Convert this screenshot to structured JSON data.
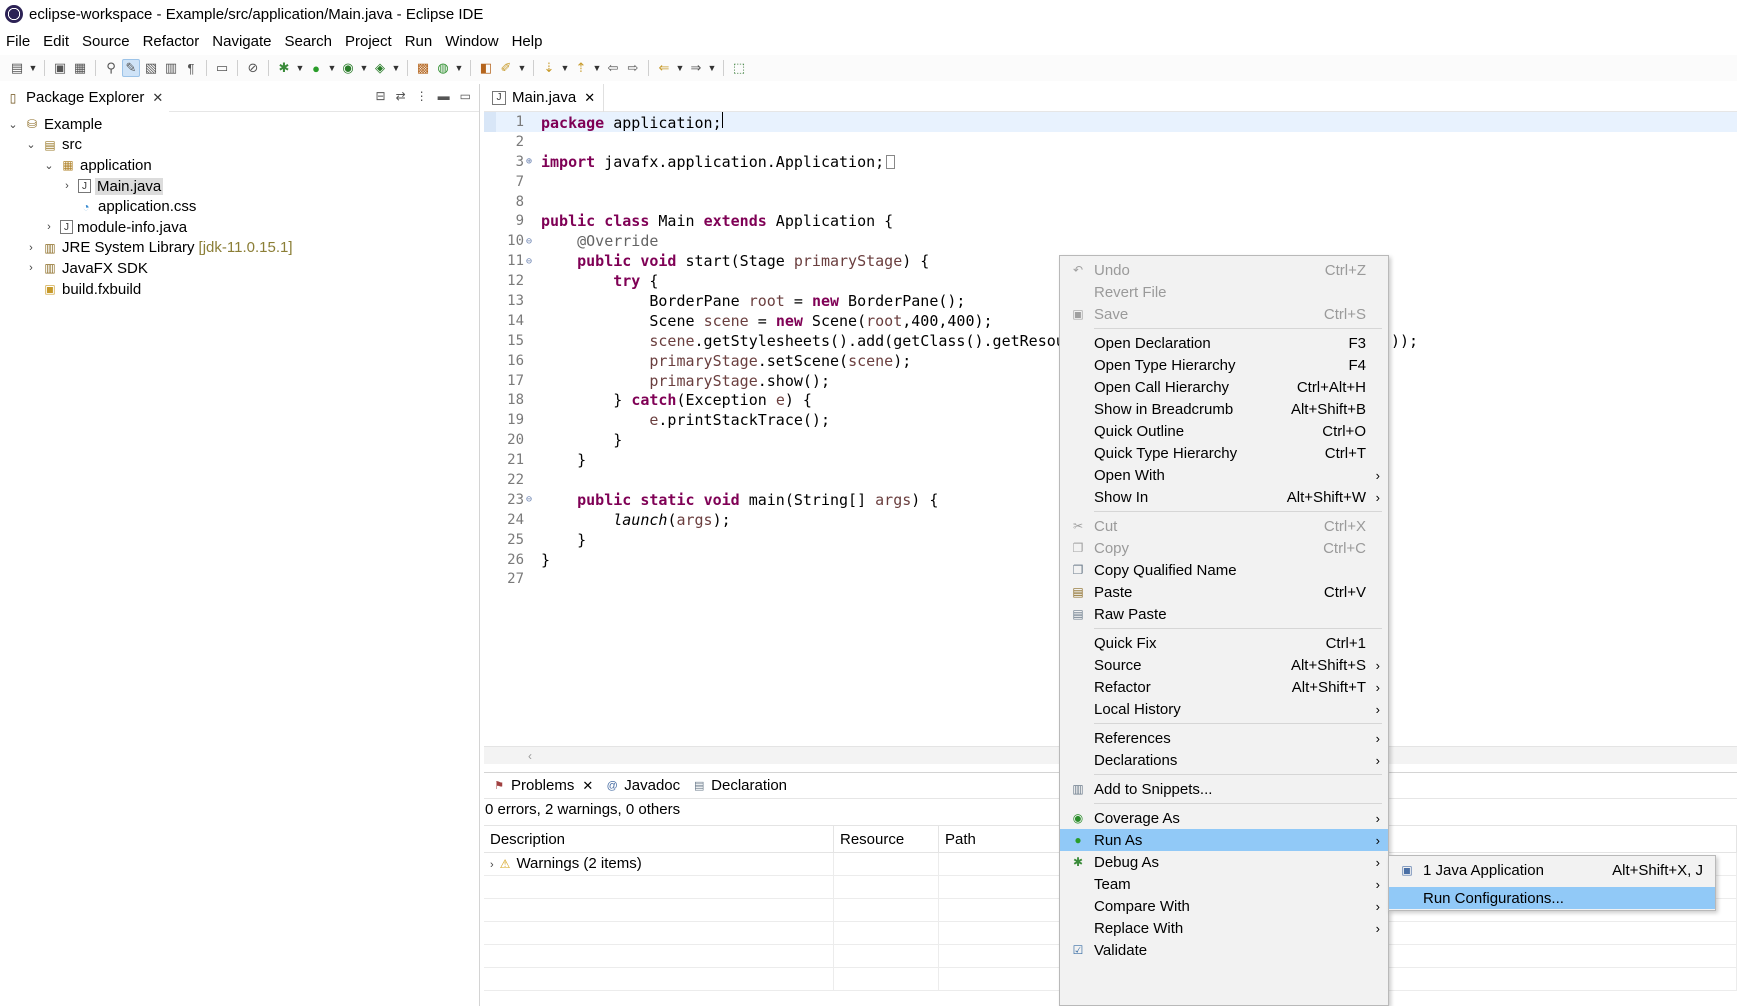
{
  "window": {
    "title": "eclipse-workspace - Example/src/application/Main.java - Eclipse IDE"
  },
  "menubar": [
    "File",
    "Edit",
    "Source",
    "Refactor",
    "Navigate",
    "Search",
    "Project",
    "Run",
    "Window",
    "Help"
  ],
  "package_explorer": {
    "title": "Package Explorer",
    "tree": [
      {
        "label": "Example",
        "icon": "project-icon",
        "twisty": "expanded",
        "indent": 0
      },
      {
        "label": "src",
        "icon": "source-folder-icon",
        "twisty": "expanded",
        "indent": 1
      },
      {
        "label": "application",
        "icon": "package-icon",
        "twisty": "expanded",
        "indent": 2
      },
      {
        "label": "Main.java",
        "icon": "java-file-icon",
        "twisty": "collapsed",
        "indent": 3,
        "selected": true
      },
      {
        "label": "application.css",
        "icon": "css-file-icon",
        "twisty": "none",
        "indent": 3
      },
      {
        "label": "module-info.java",
        "icon": "java-file-icon",
        "twisty": "collapsed",
        "indent": 2
      },
      {
        "label": "JRE System Library",
        "decoration": "[jdk-11.0.15.1]",
        "icon": "library-icon",
        "twisty": "collapsed",
        "indent": 1
      },
      {
        "label": "JavaFX SDK",
        "icon": "library-icon",
        "twisty": "collapsed",
        "indent": 1
      },
      {
        "label": "build.fxbuild",
        "icon": "fxbuild-file-icon",
        "twisty": "none",
        "indent": 1
      }
    ]
  },
  "editor": {
    "tab_label": "Main.java",
    "lines": [
      {
        "no": "1",
        "current": true
      },
      {
        "no": "2"
      },
      {
        "no": "3",
        "fold": "+"
      },
      {
        "no": "7"
      },
      {
        "no": "8"
      },
      {
        "no": "9"
      },
      {
        "no": "10",
        "fold": "-"
      },
      {
        "no": "11",
        "fold": "-"
      },
      {
        "no": "12"
      },
      {
        "no": "13"
      },
      {
        "no": "14"
      },
      {
        "no": "15"
      },
      {
        "no": "16"
      },
      {
        "no": "17"
      },
      {
        "no": "18"
      },
      {
        "no": "19"
      },
      {
        "no": "20"
      },
      {
        "no": "21"
      },
      {
        "no": "22"
      },
      {
        "no": "23",
        "fold": "-"
      },
      {
        "no": "24"
      },
      {
        "no": "25"
      },
      {
        "no": "26"
      },
      {
        "no": "27"
      }
    ],
    "code": {
      "l1a": "package",
      "l1b": " application;",
      "l3a": "import",
      "l3b": " javafx.application.Application;",
      "l9a": "public",
      "l9b": " ",
      "l9c": "class",
      "l9d": " Main ",
      "l9e": "extends",
      "l9f": " Application {",
      "l10": "    @Override",
      "l11a": "    ",
      "l11b": "public",
      "l11c": " ",
      "l11d": "void",
      "l11e": " start(Stage ",
      "l11f": "primaryStage",
      "l11g": ") {",
      "l12a": "        ",
      "l12b": "try",
      "l12c": " {",
      "l13a": "            BorderPane ",
      "l13b": "root",
      "l13c": " = ",
      "l13d": "new",
      "l13e": " BorderPane();",
      "l14a": "            Scene ",
      "l14b": "scene",
      "l14c": " = ",
      "l14d": "new",
      "l14e": " Scene(",
      "l14f": "root",
      "l14g": ",400,400);",
      "l15a": "            ",
      "l15b": "scene",
      "l15c": ".getStylesheets().add(getClass().getResou",
      "l15tail": "));",
      "l16a": "            ",
      "l16b": "primaryStage",
      "l16c": ".setScene(",
      "l16d": "scene",
      "l16e": ");",
      "l17a": "            ",
      "l17b": "primaryStage",
      "l17c": ".show();",
      "l18a": "        } ",
      "l18b": "catch",
      "l18c": "(Exception ",
      "l18d": "e",
      "l18e": ") {",
      "l19a": "            ",
      "l19b": "e",
      "l19c": ".printStackTrace();",
      "l20": "        }",
      "l21": "    }",
      "l23a": "    ",
      "l23b": "public",
      "l23c": " ",
      "l23d": "static",
      "l23e": " ",
      "l23f": "void",
      "l23g": " main(String[] ",
      "l23h": "args",
      "l23i": ") {",
      "l24a": "        ",
      "l24b": "launch",
      "l24c": "(",
      "l24d": "args",
      "l24e": ");",
      "l25": "    }",
      "l26": "}"
    }
  },
  "bottom_panel": {
    "tabs": [
      {
        "label": "Problems",
        "icon": "problems-icon",
        "closable": true
      },
      {
        "label": "Javadoc",
        "icon": "javadoc-icon"
      },
      {
        "label": "Declaration",
        "icon": "declaration-icon"
      }
    ],
    "summary": "0 errors, 2 warnings, 0 others",
    "columns": [
      "Description",
      "Resource",
      "Path"
    ],
    "rows": [
      {
        "description": "Warnings (2 items)",
        "resource": "",
        "path": ""
      }
    ]
  },
  "context_menu": {
    "items": [
      {
        "label": "Undo",
        "shortcut": "Ctrl+Z",
        "disabled": true,
        "icon": "undo-icon"
      },
      {
        "label": "Revert File",
        "disabled": true
      },
      {
        "label": "Save",
        "shortcut": "Ctrl+S",
        "disabled": true,
        "icon": "save-icon"
      },
      {
        "separator": true
      },
      {
        "label": "Open Declaration",
        "shortcut": "F3"
      },
      {
        "label": "Open Type Hierarchy",
        "shortcut": "F4"
      },
      {
        "label": "Open Call Hierarchy",
        "shortcut": "Ctrl+Alt+H"
      },
      {
        "label": "Show in Breadcrumb",
        "shortcut": "Alt+Shift+B"
      },
      {
        "label": "Quick Outline",
        "shortcut": "Ctrl+O"
      },
      {
        "label": "Quick Type Hierarchy",
        "shortcut": "Ctrl+T"
      },
      {
        "label": "Open With",
        "submenu": true
      },
      {
        "label": "Show In",
        "shortcut": "Alt+Shift+W",
        "submenu": true
      },
      {
        "separator": true
      },
      {
        "label": "Cut",
        "shortcut": "Ctrl+X",
        "disabled": true,
        "icon": "cut-icon"
      },
      {
        "label": "Copy",
        "shortcut": "Ctrl+C",
        "disabled": true,
        "icon": "copy-icon"
      },
      {
        "label": "Copy Qualified Name",
        "icon": "copy-qualified-icon"
      },
      {
        "label": "Paste",
        "shortcut": "Ctrl+V",
        "icon": "paste-icon"
      },
      {
        "label": "Raw Paste",
        "icon": "raw-paste-icon"
      },
      {
        "separator": true
      },
      {
        "label": "Quick Fix",
        "shortcut": "Ctrl+1"
      },
      {
        "label": "Source",
        "shortcut": "Alt+Shift+S",
        "submenu": true
      },
      {
        "label": "Refactor",
        "shortcut": "Alt+Shift+T",
        "submenu": true
      },
      {
        "label": "Local History",
        "submenu": true
      },
      {
        "separator": true
      },
      {
        "label": "References",
        "submenu": true
      },
      {
        "label": "Declarations",
        "submenu": true
      },
      {
        "separator": true
      },
      {
        "label": "Add to Snippets...",
        "icon": "snippets-icon"
      },
      {
        "separator": true
      },
      {
        "label": "Coverage As",
        "submenu": true,
        "icon": "coverage-icon"
      },
      {
        "label": "Run As",
        "submenu": true,
        "highlight": true,
        "icon": "run-icon"
      },
      {
        "label": "Debug As",
        "submenu": true,
        "icon": "debug-icon"
      },
      {
        "label": "Team",
        "submenu": true
      },
      {
        "label": "Compare With",
        "submenu": true
      },
      {
        "label": "Replace With",
        "submenu": true
      },
      {
        "label": "Validate",
        "icon": "validate-check-icon"
      }
    ]
  },
  "run_as_submenu": {
    "items": [
      {
        "label": "1 Java Application",
        "shortcut": "Alt+Shift+X, J",
        "icon": "java-app-icon"
      },
      {
        "label": "Run Configurations...",
        "highlight": true
      }
    ]
  },
  "colors": {
    "keyword": "#7f0055",
    "local_var": "#6a3e3e",
    "menu_highlight": "#91c9f7",
    "menu_bg": "#f2f2f2",
    "current_line": "#e8f2fe"
  }
}
